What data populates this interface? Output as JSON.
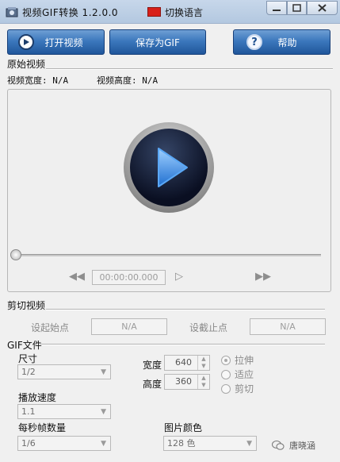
{
  "window": {
    "title": "视频GIF转换 1.2.0.0",
    "switch_language": "切换语言"
  },
  "toolbar": {
    "open_video": "打开视频",
    "save_gif": "保存为GIF",
    "help": "帮助"
  },
  "original_video": {
    "section_title": "原始视频",
    "width_label": "视频宽度: N/A",
    "height_label": "视频高度: N/A",
    "timecode": "00:00:00.000",
    "seek_position": 0
  },
  "cut_video": {
    "section_title": "剪切视频",
    "set_start_label": "设起始点",
    "start_value": "N/A",
    "set_end_label": "设截止点",
    "end_value": "N/A"
  },
  "gif_file": {
    "section_title": "GIF文件",
    "size_label": "尺寸",
    "size_value": "1/2",
    "speed_label": "播放速度",
    "speed_value": "1.1",
    "fps_label": "每秒帧数量",
    "fps_value": "1/6",
    "width_label": "宽度",
    "width_value": "640",
    "height_label": "高度",
    "height_value": "360",
    "stretch_label": "拉伸",
    "fit_label": "适应",
    "crop_label": "剪切",
    "selected_mode": "stretch",
    "color_label": "图片颜色",
    "color_value": "128 色"
  },
  "watermark": "唐晓涵",
  "colors": {
    "button_blue": "#3c78bd",
    "flag_red": "#d8201a",
    "title_bar": "#c7d7ea"
  }
}
